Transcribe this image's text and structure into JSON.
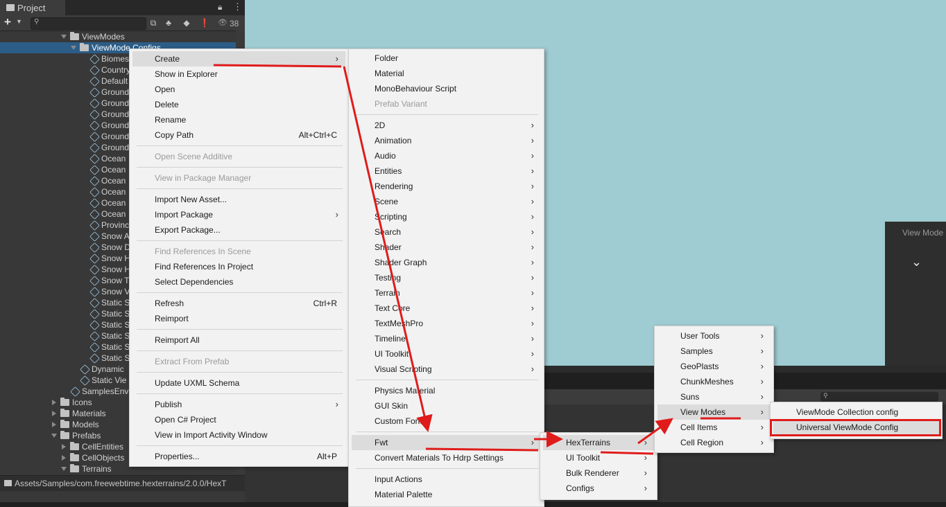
{
  "project_panel": {
    "tab_title": "Project",
    "toolbar": {
      "add_label": "+",
      "eye_count": "38"
    },
    "tree": [
      {
        "label": "ViewModes",
        "type": "folder",
        "indent": 0,
        "expanded": true
      },
      {
        "label": "ViewMode Configs",
        "type": "folder",
        "indent": 1,
        "expanded": true,
        "selected": true
      },
      {
        "label": "Biomes",
        "type": "asset",
        "indent": 2
      },
      {
        "label": "Country",
        "type": "asset",
        "indent": 2
      },
      {
        "label": "Default",
        "type": "asset",
        "indent": 2
      },
      {
        "label": "Ground",
        "type": "asset",
        "indent": 2
      },
      {
        "label": "Ground",
        "type": "asset",
        "indent": 2
      },
      {
        "label": "Ground",
        "type": "asset",
        "indent": 2
      },
      {
        "label": "Ground",
        "type": "asset",
        "indent": 2
      },
      {
        "label": "Ground",
        "type": "asset",
        "indent": 2
      },
      {
        "label": "Ground",
        "type": "asset",
        "indent": 2
      },
      {
        "label": "Ocean",
        "type": "asset",
        "indent": 2
      },
      {
        "label": "Ocean",
        "type": "asset",
        "indent": 2
      },
      {
        "label": "Ocean",
        "type": "asset",
        "indent": 2
      },
      {
        "label": "Ocean",
        "type": "asset",
        "indent": 2
      },
      {
        "label": "Ocean",
        "type": "asset",
        "indent": 2
      },
      {
        "label": "Ocean",
        "type": "asset",
        "indent": 2
      },
      {
        "label": "Province",
        "type": "asset",
        "indent": 2
      },
      {
        "label": "Snow A",
        "type": "asset",
        "indent": 2
      },
      {
        "label": "Snow D",
        "type": "asset",
        "indent": 2
      },
      {
        "label": "Snow H",
        "type": "asset",
        "indent": 2
      },
      {
        "label": "Snow H",
        "type": "asset",
        "indent": 2
      },
      {
        "label": "Snow T",
        "type": "asset",
        "indent": 2
      },
      {
        "label": "Snow V",
        "type": "asset",
        "indent": 2
      },
      {
        "label": "Static S",
        "type": "asset",
        "indent": 2
      },
      {
        "label": "Static S",
        "type": "asset",
        "indent": 2
      },
      {
        "label": "Static S",
        "type": "asset",
        "indent": 2
      },
      {
        "label": "Static S",
        "type": "asset",
        "indent": 2
      },
      {
        "label": "Static S",
        "type": "asset",
        "indent": 2
      },
      {
        "label": "Static S",
        "type": "asset",
        "indent": 2
      },
      {
        "label": "Dynamic",
        "type": "asset",
        "indent": 1
      },
      {
        "label": "Static Vie",
        "type": "asset",
        "indent": 1
      },
      {
        "label": "SamplesEnv",
        "type": "asset",
        "indent": 0
      },
      {
        "label": "Icons",
        "type": "folder",
        "indent": -1,
        "expanded": false
      },
      {
        "label": "Materials",
        "type": "folder",
        "indent": -1,
        "expanded": false
      },
      {
        "label": "Models",
        "type": "folder",
        "indent": -1,
        "expanded": false
      },
      {
        "label": "Prefabs",
        "type": "folder",
        "indent": -1,
        "expanded": true
      },
      {
        "label": "CellEntities",
        "type": "folder",
        "indent": 0,
        "expanded": false
      },
      {
        "label": "CellObjects",
        "type": "folder",
        "indent": 0,
        "expanded": false
      },
      {
        "label": "Terrains",
        "type": "folder",
        "indent": 0,
        "expanded": true
      }
    ],
    "status_path": "Assets/Samples/com.freewebtime.hexterrains/2.0.0/HexT"
  },
  "scene_overlay": {
    "title": "View Mode"
  },
  "context_menu": [
    {
      "label": "Create",
      "submenu": true,
      "highlighted": true
    },
    {
      "label": "Show in Explorer"
    },
    {
      "label": "Open"
    },
    {
      "label": "Delete"
    },
    {
      "label": "Rename"
    },
    {
      "label": "Copy Path",
      "shortcut": "Alt+Ctrl+C"
    },
    {
      "sep": true
    },
    {
      "label": "Open Scene Additive",
      "disabled": true
    },
    {
      "sep": true
    },
    {
      "label": "View in Package Manager",
      "disabled": true
    },
    {
      "sep": true
    },
    {
      "label": "Import New Asset..."
    },
    {
      "label": "Import Package",
      "submenu": true
    },
    {
      "label": "Export Package..."
    },
    {
      "sep": true
    },
    {
      "label": "Find References In Scene",
      "disabled": true
    },
    {
      "label": "Find References In Project"
    },
    {
      "label": "Select Dependencies"
    },
    {
      "sep": true
    },
    {
      "label": "Refresh",
      "shortcut": "Ctrl+R"
    },
    {
      "label": "Reimport"
    },
    {
      "sep": true
    },
    {
      "label": "Reimport All"
    },
    {
      "sep": true
    },
    {
      "label": "Extract From Prefab",
      "disabled": true
    },
    {
      "sep": true
    },
    {
      "label": "Update UXML Schema"
    },
    {
      "sep": true
    },
    {
      "label": "Publish",
      "submenu": true
    },
    {
      "label": "Open C# Project"
    },
    {
      "label": "View in Import Activity Window"
    },
    {
      "sep": true
    },
    {
      "label": "Properties...",
      "shortcut": "Alt+P"
    }
  ],
  "create_menu": [
    {
      "label": "Folder"
    },
    {
      "label": "Material"
    },
    {
      "label": "MonoBehaviour Script"
    },
    {
      "label": "Prefab Variant",
      "disabled": true
    },
    {
      "sep": true
    },
    {
      "label": "2D",
      "submenu": true
    },
    {
      "label": "Animation",
      "submenu": true
    },
    {
      "label": "Audio",
      "submenu": true
    },
    {
      "label": "Entities",
      "submenu": true
    },
    {
      "label": "Rendering",
      "submenu": true
    },
    {
      "label": "Scene",
      "submenu": true
    },
    {
      "label": "Scripting",
      "submenu": true
    },
    {
      "label": "Search",
      "submenu": true
    },
    {
      "label": "Shader",
      "submenu": true
    },
    {
      "label": "Shader Graph",
      "submenu": true
    },
    {
      "label": "Testing",
      "submenu": true
    },
    {
      "label": "Terrain",
      "submenu": true
    },
    {
      "label": "Text Core",
      "submenu": true
    },
    {
      "label": "TextMeshPro",
      "submenu": true
    },
    {
      "label": "Timeline",
      "submenu": true
    },
    {
      "label": "UI Toolkit",
      "submenu": true
    },
    {
      "label": "Visual Scripting",
      "submenu": true
    },
    {
      "sep": true
    },
    {
      "label": "Physics Material"
    },
    {
      "label": "GUI Skin"
    },
    {
      "label": "Custom Font"
    },
    {
      "sep": true
    },
    {
      "label": "Fwt",
      "submenu": true,
      "highlighted": true
    },
    {
      "label": "Convert Materials To Hdrp Settings"
    },
    {
      "sep": true
    },
    {
      "label": "Input Actions"
    },
    {
      "label": "Material Palette"
    }
  ],
  "fwt_menu": [
    {
      "label": "HexTerrains",
      "submenu": true,
      "highlighted": true
    },
    {
      "label": "UI Toolkit",
      "submenu": true
    },
    {
      "label": "Bulk Renderer",
      "submenu": true
    },
    {
      "label": "Configs",
      "submenu": true
    }
  ],
  "hexterrains_menu": [
    {
      "label": "User Tools",
      "submenu": true
    },
    {
      "label": "Samples",
      "submenu": true
    },
    {
      "label": "GeoPlasts",
      "submenu": true
    },
    {
      "label": "ChunkMeshes",
      "submenu": true
    },
    {
      "label": "Suns",
      "submenu": true
    },
    {
      "label": "View Modes",
      "submenu": true,
      "highlighted": true
    },
    {
      "label": "Cell Items",
      "submenu": true
    },
    {
      "label": "Cell Region",
      "submenu": true
    }
  ],
  "viewmodes_menu": [
    {
      "label": "ViewMode Collection config"
    },
    {
      "label": "Universal ViewMode Config",
      "highlighted": true
    }
  ],
  "annotation_color": "#e01b1b"
}
